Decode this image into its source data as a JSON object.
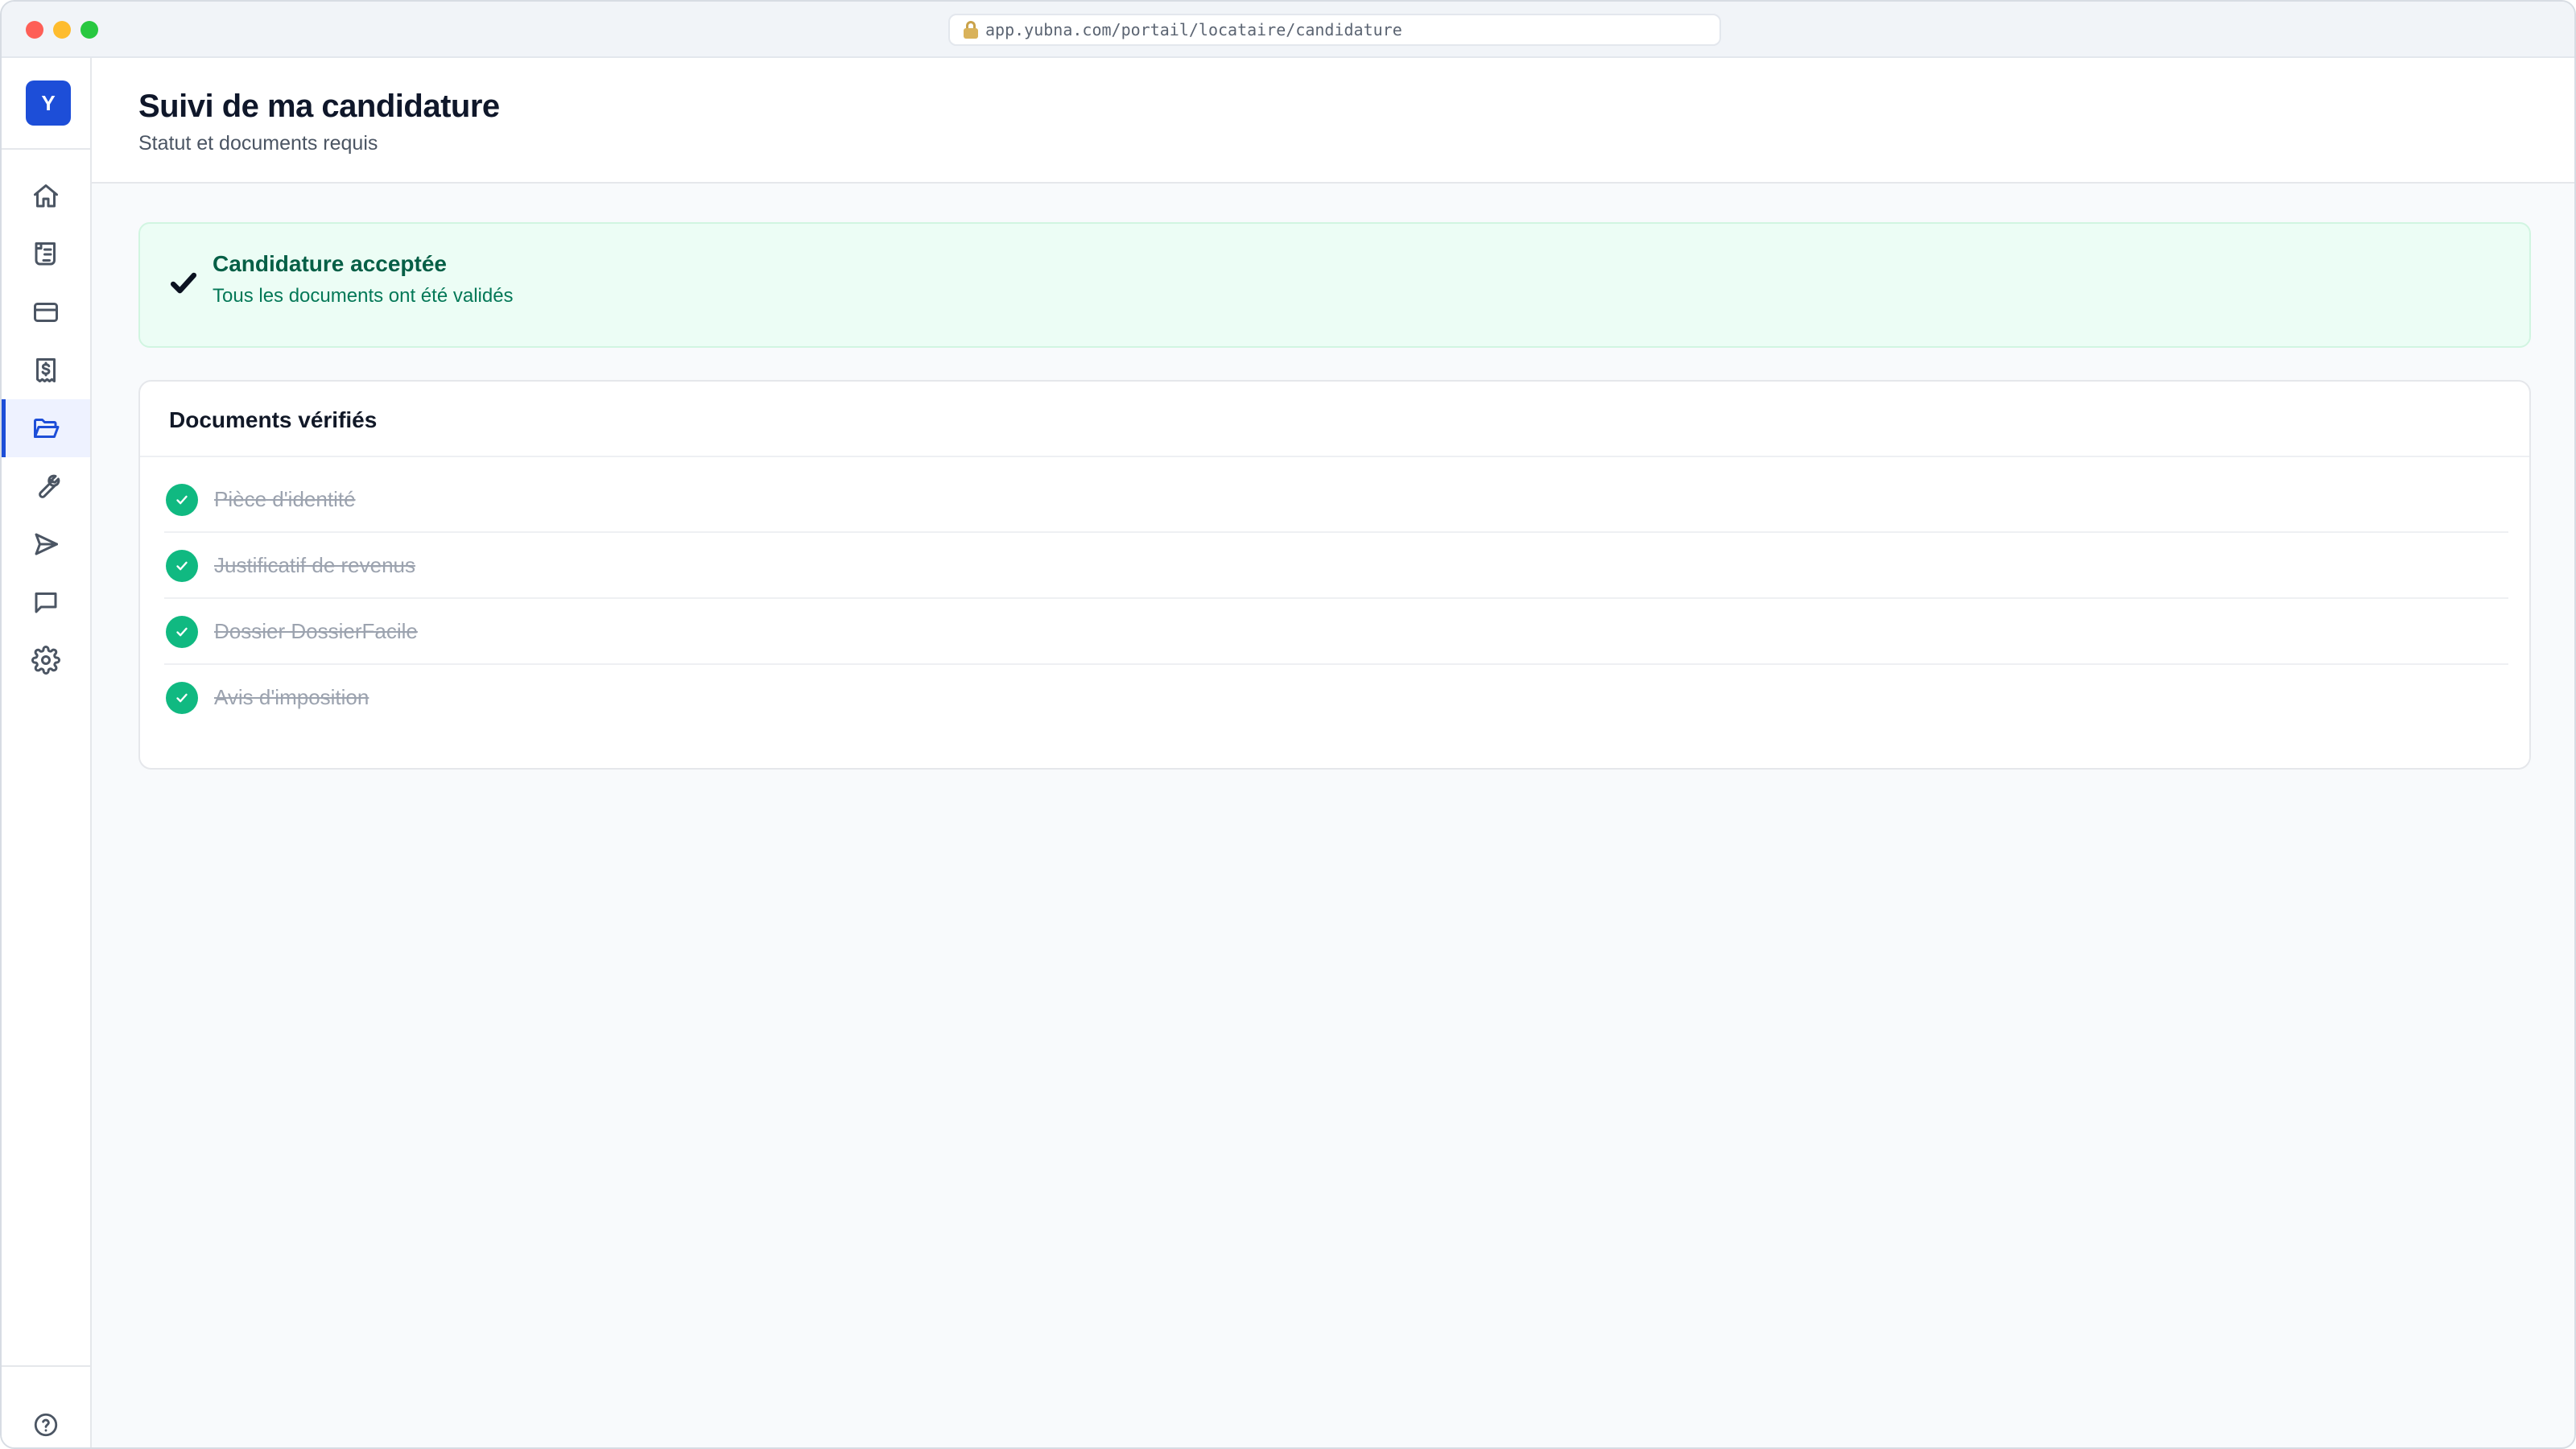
{
  "browser": {
    "url": "app.yubna.com/portail/locataire/candidature"
  },
  "sidebar": {
    "logo": "Y",
    "items": [
      {
        "icon": "home-icon",
        "active": false
      },
      {
        "icon": "scroll-icon",
        "active": false
      },
      {
        "icon": "credit-card-icon",
        "active": false
      },
      {
        "icon": "receipt-dollar-icon",
        "active": false
      },
      {
        "icon": "folder-open-icon",
        "active": true
      },
      {
        "icon": "wrench-icon",
        "active": false
      },
      {
        "icon": "send-icon",
        "active": false
      },
      {
        "icon": "message-icon",
        "active": false
      },
      {
        "icon": "gear-icon",
        "active": false
      }
    ],
    "help_icon": "help-circle-icon"
  },
  "header": {
    "title": "Suivi de ma candidature",
    "subtitle": "Statut et documents requis"
  },
  "banner": {
    "title": "Candidature acceptée",
    "text": "Tous les documents ont été validés"
  },
  "documents": {
    "title": "Documents vérifiés",
    "items": [
      {
        "label": "Pièce d'identité",
        "status": "verified"
      },
      {
        "label": "Justificatif de revenus",
        "status": "verified"
      },
      {
        "label": "Dossier DossierFacile",
        "status": "verified"
      },
      {
        "label": "Avis d'imposition",
        "status": "verified"
      }
    ]
  },
  "colors": {
    "accent": "#1d4ed8",
    "success": "#10b981",
    "banner_bg": "#ecfdf5",
    "banner_title": "#065f46"
  }
}
